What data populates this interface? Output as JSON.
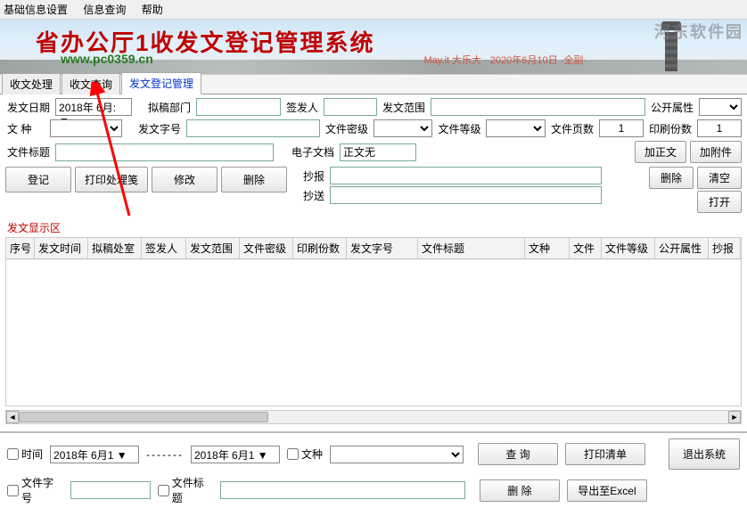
{
  "menu": {
    "basic": "基础信息设置",
    "query": "信息查询",
    "help": "帮助"
  },
  "banner": {
    "title": "省办公厅1收发文登记管理系统",
    "url": "www.pc0359.cn",
    "watermark": "河东软件园",
    "subtext": "May.it 大乐大 · 2020年6月10日 ·全副·"
  },
  "tabs": [
    {
      "label": "收文处理"
    },
    {
      "label": "收文查询"
    },
    {
      "label": "发文登记管理",
      "active": true
    }
  ],
  "form": {
    "row1": {
      "date_label": "发文日期",
      "date_value": "2018年 6月: ▼",
      "dept_label": "拟稿部门",
      "signer_label": "签发人",
      "scope_label": "发文范围",
      "public_label": "公开属性"
    },
    "row2": {
      "type_label": "文    种",
      "docno_label": "发文字号",
      "sec_label": "文件密级",
      "grade_label": "文件等级",
      "pages_label": "文件页数",
      "pages_value": "1",
      "copies_label": "印刷份数",
      "copies_value": "1"
    },
    "row3": {
      "title_label": "文件标题",
      "efile_label": "电子文档",
      "efile_value": "正文无",
      "btn_add_body": "加正文",
      "btn_add_attach": "加附件"
    },
    "row4": {
      "btn_reg": "登记",
      "btn_print": "打印处理笺",
      "btn_edit": "修改",
      "btn_del": "删除",
      "cc1_label": "抄报",
      "cc2_label": "抄送",
      "btn_delete2": "删除",
      "btn_clear": "清空",
      "btn_open": "打开"
    }
  },
  "section_label": "发文显示区",
  "columns": [
    "序号",
    "发文时间",
    "拟稿处室",
    "签发人",
    "发文范围",
    "文件密级",
    "印刷份数",
    "发文字号",
    "文件标题",
    "文种",
    "文件",
    "文件等级",
    "公开属性",
    "抄报"
  ],
  "filter": {
    "time_label": "时间",
    "date1": "2018年 6月1",
    "dash": "-------",
    "date2": "2018年 6月1",
    "doctype_label": "文种",
    "docno_label": "文件字号",
    "title_label": "文件标题",
    "btn_search": "查      询",
    "btn_del": "删      除",
    "btn_printlist": "打印清单",
    "btn_export": "导出至Excel",
    "btn_exit": "退出系统"
  }
}
